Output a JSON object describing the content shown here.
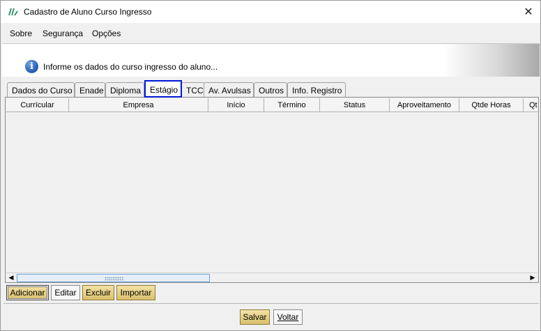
{
  "window": {
    "title": "Cadastro de Aluno Curso Ingresso"
  },
  "menu": {
    "items": [
      "Sobre",
      "Segurança",
      "Opções"
    ]
  },
  "info": {
    "message": "Informe os dados do curso ingresso do aluno..."
  },
  "tabs": [
    {
      "label": "Dados do Curso"
    },
    {
      "label": "Enade"
    },
    {
      "label": "Diploma"
    },
    {
      "label": "Estágio",
      "active": true
    },
    {
      "label": "TCC"
    },
    {
      "label": "Av. Avulsas"
    },
    {
      "label": "Outros"
    },
    {
      "label": "Info. Registro"
    }
  ],
  "table": {
    "columns": [
      "Currícular",
      "Empresa",
      "Início",
      "Término",
      "Status",
      "Aproveitamento",
      "Qtde Horas",
      "Qt"
    ],
    "rows": []
  },
  "actions": {
    "add": "Adicionar",
    "edit": "Editar",
    "delete": "Excluir",
    "import": "Importar"
  },
  "footer": {
    "save": "Salvar",
    "back": "Voltar"
  },
  "colors": {
    "active_tab_border": "#0018d6",
    "gold_button": "#e6cf84",
    "info_icon": "#2d62b8"
  }
}
